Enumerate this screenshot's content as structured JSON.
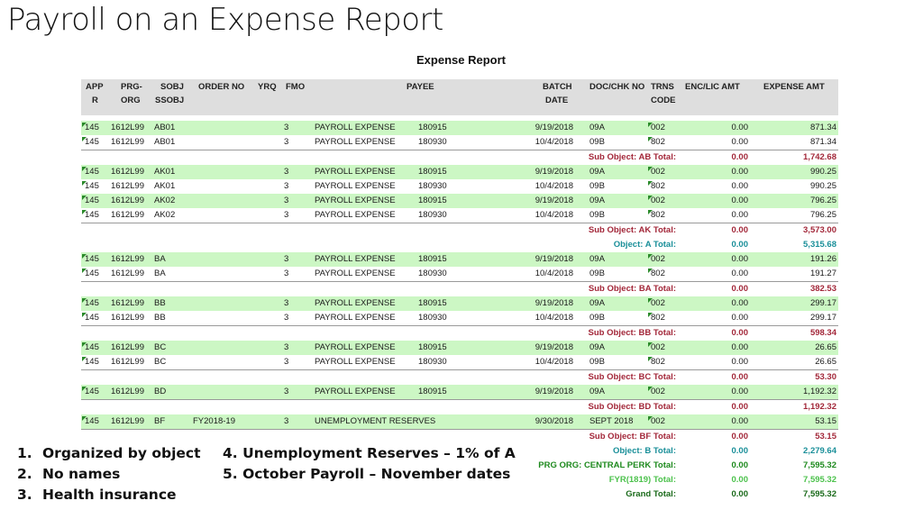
{
  "slide": {
    "title": "Payroll on an Expense Report",
    "notes_left": [
      {
        "num": "1.",
        "text": "Organized by object"
      },
      {
        "num": "2.",
        "text": "No names"
      },
      {
        "num": "3.",
        "text": "Health insurance"
      }
    ],
    "notes_right": [
      "4. Unemployment Reserves – 1% of A",
      "5. October Payroll – November dates"
    ]
  },
  "report": {
    "title": "Expense Report",
    "colors": {
      "green_row": "#ccf7c4",
      "sub_object": "#a3283a",
      "object": "#1a8f99",
      "prg_org": "#1e8a1e",
      "fyr": "#4cc24c",
      "grand": "#1a6a1a"
    },
    "headers": {
      "appr_1": "APP",
      "appr_2": "R",
      "prg_1": "PRG-",
      "prg_2": "ORG",
      "sobj_1": "SOBJ",
      "sobj_2": "SSOBJ",
      "order": "ORDER NO",
      "yrq": "YRQ",
      "fmo": "FMO",
      "payee": "PAYEE",
      "batch_1": "BATCH",
      "batch_2": "DATE",
      "doc": "DOC/CHK NO",
      "trns_1": "TRNS",
      "trns_2": "CODE",
      "enc": "ENC/LIC AMT",
      "expense": "EXPENSE AMT"
    },
    "rows": [
      {
        "appr": "145",
        "prg": "1612L99",
        "sobj": "AB01",
        "order": "",
        "fmo": "3",
        "payee": "PAYROLL EXPENSE",
        "payee_id": "180915",
        "date": "9/19/2018",
        "doc": "09A",
        "trns": "002",
        "enc": "0.00",
        "exp": "871.34"
      },
      {
        "appr": "145",
        "prg": "1612L99",
        "sobj": "AB01",
        "order": "",
        "fmo": "3",
        "payee": "PAYROLL EXPENSE",
        "payee_id": "180930",
        "date": "10/4/2018",
        "doc": "09B",
        "trns": "802",
        "enc": "0.00",
        "exp": "871.34"
      },
      {
        "label": "Sub Object: AB Total:",
        "enc": "0.00",
        "exp": "1,742.68"
      },
      {
        "appr": "145",
        "prg": "1612L99",
        "sobj": "AK01",
        "order": "",
        "fmo": "3",
        "payee": "PAYROLL EXPENSE",
        "payee_id": "180915",
        "date": "9/19/2018",
        "doc": "09A",
        "trns": "002",
        "enc": "0.00",
        "exp": "990.25"
      },
      {
        "appr": "145",
        "prg": "1612L99",
        "sobj": "AK01",
        "order": "",
        "fmo": "3",
        "payee": "PAYROLL EXPENSE",
        "payee_id": "180930",
        "date": "10/4/2018",
        "doc": "09B",
        "trns": "802",
        "enc": "0.00",
        "exp": "990.25"
      },
      {
        "appr": "145",
        "prg": "1612L99",
        "sobj": "AK02",
        "order": "",
        "fmo": "3",
        "payee": "PAYROLL EXPENSE",
        "payee_id": "180915",
        "date": "9/19/2018",
        "doc": "09A",
        "trns": "002",
        "enc": "0.00",
        "exp": "796.25"
      },
      {
        "appr": "145",
        "prg": "1612L99",
        "sobj": "AK02",
        "order": "",
        "fmo": "3",
        "payee": "PAYROLL EXPENSE",
        "payee_id": "180930",
        "date": "10/4/2018",
        "doc": "09B",
        "trns": "802",
        "enc": "0.00",
        "exp": "796.25"
      },
      {
        "label": "Sub Object: AK Total:",
        "enc": "0.00",
        "exp": "3,573.00"
      },
      {
        "label": "Object: A Total:",
        "enc": "0.00",
        "exp": "5,315.68"
      },
      {
        "appr": "145",
        "prg": "1612L99",
        "sobj": "BA",
        "order": "",
        "fmo": "3",
        "payee": "PAYROLL EXPENSE",
        "payee_id": "180915",
        "date": "9/19/2018",
        "doc": "09A",
        "trns": "002",
        "enc": "0.00",
        "exp": "191.26"
      },
      {
        "appr": "145",
        "prg": "1612L99",
        "sobj": "BA",
        "order": "",
        "fmo": "3",
        "payee": "PAYROLL EXPENSE",
        "payee_id": "180930",
        "date": "10/4/2018",
        "doc": "09B",
        "trns": "802",
        "enc": "0.00",
        "exp": "191.27"
      },
      {
        "label": "Sub Object: BA Total:",
        "enc": "0.00",
        "exp": "382.53"
      },
      {
        "appr": "145",
        "prg": "1612L99",
        "sobj": "BB",
        "order": "",
        "fmo": "3",
        "payee": "PAYROLL EXPENSE",
        "payee_id": "180915",
        "date": "9/19/2018",
        "doc": "09A",
        "trns": "002",
        "enc": "0.00",
        "exp": "299.17"
      },
      {
        "appr": "145",
        "prg": "1612L99",
        "sobj": "BB",
        "order": "",
        "fmo": "3",
        "payee": "PAYROLL EXPENSE",
        "payee_id": "180930",
        "date": "10/4/2018",
        "doc": "09B",
        "trns": "802",
        "enc": "0.00",
        "exp": "299.17"
      },
      {
        "label": "Sub Object: BB Total:",
        "enc": "0.00",
        "exp": "598.34"
      },
      {
        "appr": "145",
        "prg": "1612L99",
        "sobj": "BC",
        "order": "",
        "fmo": "3",
        "payee": "PAYROLL EXPENSE",
        "payee_id": "180915",
        "date": "9/19/2018",
        "doc": "09A",
        "trns": "002",
        "enc": "0.00",
        "exp": "26.65"
      },
      {
        "appr": "145",
        "prg": "1612L99",
        "sobj": "BC",
        "order": "",
        "fmo": "3",
        "payee": "PAYROLL EXPENSE",
        "payee_id": "180930",
        "date": "10/4/2018",
        "doc": "09B",
        "trns": "802",
        "enc": "0.00",
        "exp": "26.65"
      },
      {
        "label": "Sub Object: BC Total:",
        "enc": "0.00",
        "exp": "53.30"
      },
      {
        "appr": "145",
        "prg": "1612L99",
        "sobj": "BD",
        "order": "",
        "fmo": "3",
        "payee": "PAYROLL EXPENSE",
        "payee_id": "180915",
        "date": "9/19/2018",
        "doc": "09A",
        "trns": "002",
        "enc": "0.00",
        "exp": "1,192.32"
      },
      {
        "label": "Sub Object: BD Total:",
        "enc": "0.00",
        "exp": "1,192.32"
      },
      {
        "appr": "145",
        "prg": "1612L99",
        "sobj": "BF",
        "order": "FY2018-19",
        "fmo": "3",
        "payee": "UNEMPLOYMENT RESERVES",
        "payee_id": "",
        "date": "9/30/2018",
        "doc": "SEPT 2018",
        "trns": "002",
        "enc": "0.00",
        "exp": "53.15"
      },
      {
        "label": "Sub Object: BF Total:",
        "enc": "0.00",
        "exp": "53.15"
      },
      {
        "label": "Object: B Total:",
        "enc": "0.00",
        "exp": "2,279.64"
      },
      {
        "label": "PRG ORG: CENTRAL PERK Total:",
        "enc": "0.00",
        "exp": "7,595.32"
      },
      {
        "label": "FYR(1819) Total:",
        "enc": "0.00",
        "exp": "7,595.32"
      },
      {
        "label": "Grand Total:",
        "enc": "0.00",
        "exp": "7,595.32"
      }
    ]
  }
}
